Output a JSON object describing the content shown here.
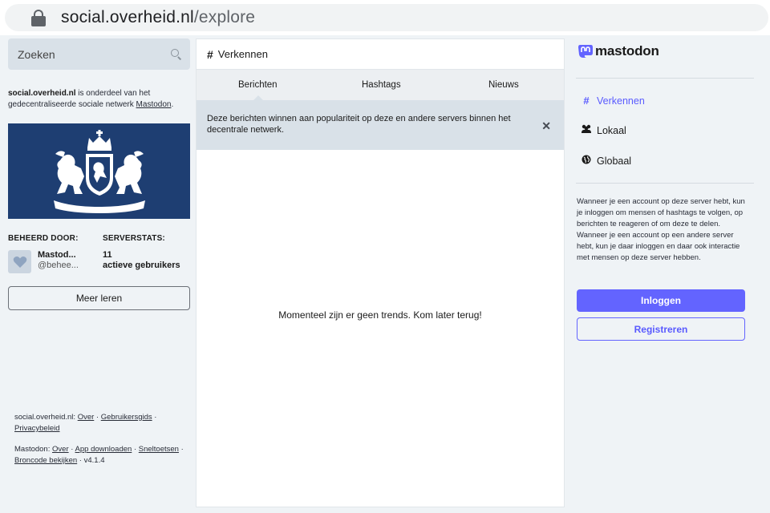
{
  "browser": {
    "url_host": "social.overheid.nl",
    "url_path": "/explore"
  },
  "left": {
    "search": {
      "placeholder": "Zoeken"
    },
    "about": {
      "server": "social.overheid.nl",
      "text": " is onderdeel van het gedecentraliseerde sociale netwerk ",
      "link": "Mastodon",
      "end": "."
    },
    "managed_by_label": "BEHEERD DOOR:",
    "serverstats_label": "SERVERSTATS:",
    "admin": {
      "name": "Mastod...",
      "handle": "@behee..."
    },
    "stats": {
      "count": "11",
      "label": "actieve gebruikers"
    },
    "learn_more": "Meer leren",
    "footer": {
      "server_label": "social.overheid.nl",
      "server_links": [
        "Over",
        "Gebruikersgids",
        "Privacybeleid"
      ],
      "mastodon_label": "Mastodon",
      "mastodon_links": [
        "Over",
        "App downloaden",
        "Sneltoetsen",
        "Broncode bekijken"
      ],
      "version": "v4.1.4"
    }
  },
  "center": {
    "title": "Verkennen",
    "tabs": [
      {
        "label": "Berichten",
        "active": true
      },
      {
        "label": "Hashtags",
        "active": false
      },
      {
        "label": "Nieuws",
        "active": false
      }
    ],
    "notice": "Deze berichten winnen aan populariteit op deze en andere servers binnen het decentrale netwerk.",
    "empty_message": "Momenteel zijn er geen trends. Kom later terug!"
  },
  "right": {
    "logo_text": "mastodon",
    "nav": [
      {
        "label": "Verkennen",
        "icon": "hash-icon",
        "active": true
      },
      {
        "label": "Lokaal",
        "icon": "users-icon",
        "active": false
      },
      {
        "label": "Globaal",
        "icon": "globe-icon",
        "active": false
      }
    ],
    "info": "Wanneer je een account op deze server hebt, kun je inloggen om mensen of hashtags te volgen, op berichten te reageren of om deze te delen. Wanneer je een account op een andere server hebt, kun je daar inloggen en daar ook interactie met mensen op deze server hebben.",
    "login": "Inloggen",
    "register": "Registreren"
  },
  "colors": {
    "accent": "#6364ff",
    "banner": "#1e3e72",
    "page_bg": "#eff3f6"
  }
}
